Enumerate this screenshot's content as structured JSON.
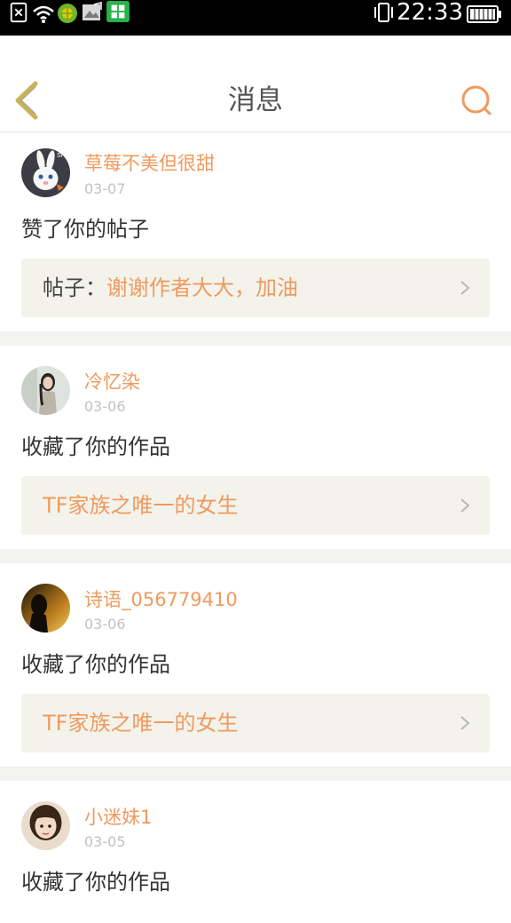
{
  "status_bar": {
    "time": "22:33",
    "icons": [
      "sim-error-icon",
      "wifi-icon",
      "app-notification-icon",
      "image-notification-icon",
      "app-grid-notification-icon",
      "vibrate-icon",
      "battery-icon"
    ]
  },
  "header": {
    "title": "消息",
    "back_icon": "chevron-left-icon",
    "search_icon": "search-icon"
  },
  "colors": {
    "accent": "#f09a5e",
    "back_arrow": "#c9b35a",
    "text_primary": "#333333",
    "text_muted": "#c2c2c2",
    "post_bg": "#f3f3ec",
    "divider_bg": "#f3f3f1"
  },
  "notifications": [
    {
      "username": "草莓不美但很甜",
      "date": "03-07",
      "action": "赞了你的帖子",
      "post_prefix": "帖子：",
      "post_title": "谢谢作者大大，加油",
      "avatar_icon": "rabbit-avatar"
    },
    {
      "username": "冷忆染",
      "date": "03-06",
      "action": "收藏了你的作品",
      "post_prefix": "",
      "post_title": "TF家族之唯一的女生",
      "avatar_icon": "girl-photo-avatar"
    },
    {
      "username": "诗语_056779410",
      "date": "03-06",
      "action": "收藏了你的作品",
      "post_prefix": "",
      "post_title": "TF家族之唯一的女生",
      "avatar_icon": "sunset-silhouette-avatar"
    },
    {
      "username": "小迷妹1",
      "date": "03-05",
      "action": "收藏了你的作品",
      "avatar_icon": "girl-portrait-avatar"
    }
  ]
}
